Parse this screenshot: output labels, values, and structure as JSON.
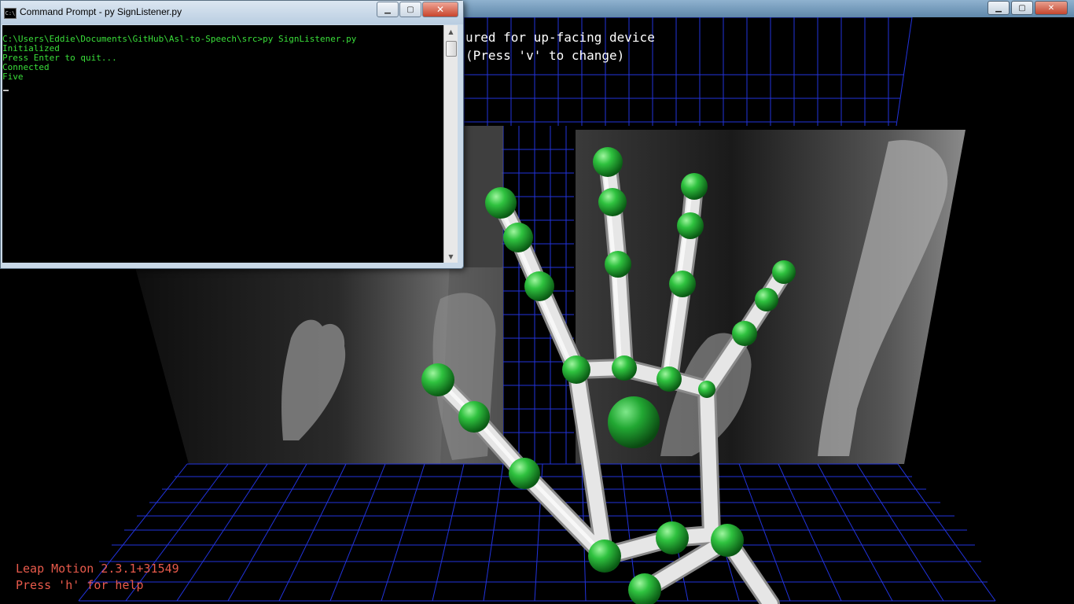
{
  "visualizer": {
    "banner_line1": "ured for up-facing device",
    "banner_line2": "(Press 'v' to change)",
    "hud_version": "Leap Motion 2.3.1+31549",
    "hud_help": "Press 'h' for help",
    "grid_color": "#2233dd",
    "joint_color": "#22aa33",
    "bone_color": "#e6e6e6"
  },
  "cmd": {
    "title": "Command Prompt - py  SignListener.py",
    "icon_label": "C:\\",
    "lines": [
      "C:\\Users\\Eddie\\Documents\\GitHub\\Asl-to-Speech\\src>py SignListener.py",
      "Initialized",
      "Press Enter to quit...",
      "Connected",
      "Five"
    ],
    "text_color": "#3adf3a"
  },
  "window_controls": {
    "minimize": "▁",
    "maximize": "▢",
    "close": "✕"
  }
}
